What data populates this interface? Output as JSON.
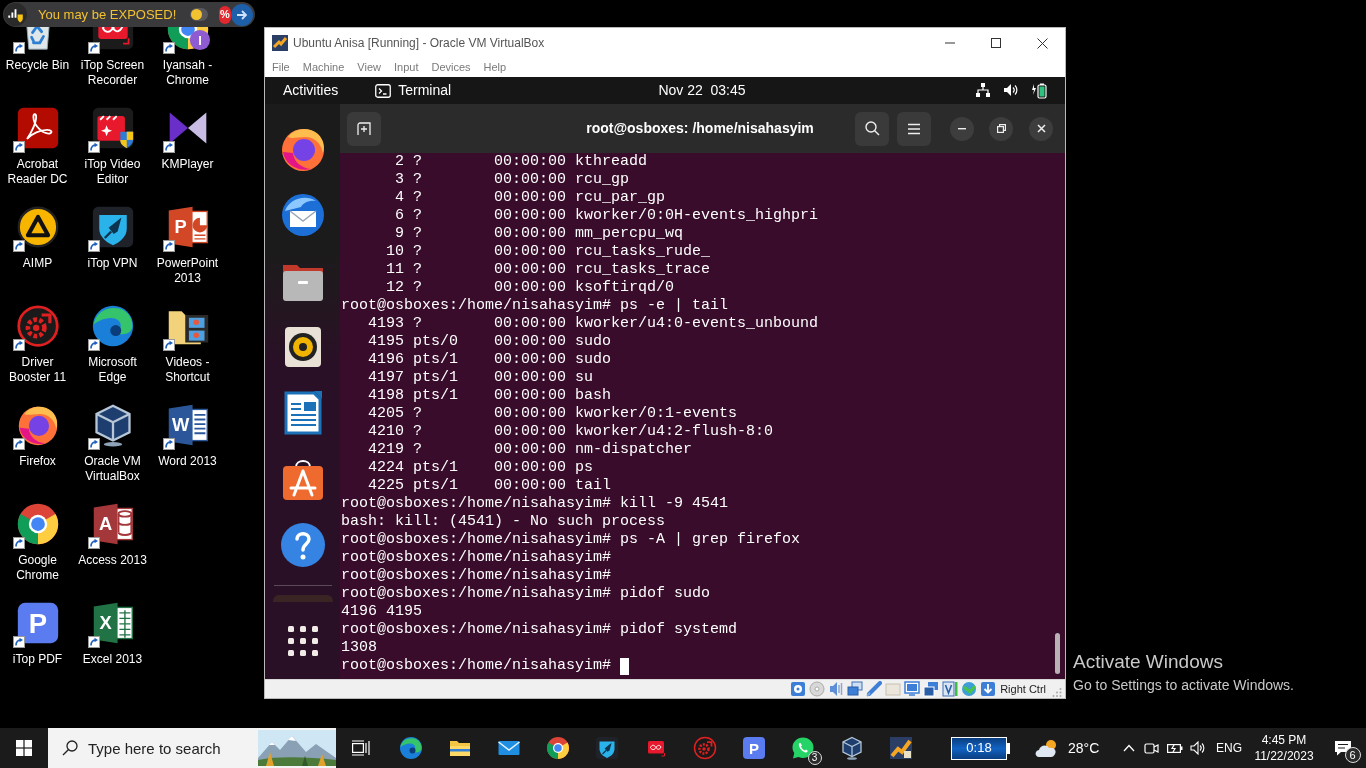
{
  "banner": {
    "text": "You may be EXPOSED!",
    "toggle": {
      "on": false
    },
    "badge": "%"
  },
  "desktop": {
    "columns": [
      [
        {
          "label": "Recycle Bin"
        },
        {
          "label": "Acrobat Reader DC"
        },
        {
          "label": "AIMP"
        },
        {
          "label": "Driver Booster 11"
        },
        {
          "label": "Firefox"
        },
        {
          "label": "Google Chrome"
        },
        {
          "label": "iTop PDF",
          "glyph": "P"
        }
      ],
      [
        {
          "label": "iTop Screen Recorder"
        },
        {
          "label": "iTop Video Editor"
        },
        {
          "label": "iTop VPN"
        },
        {
          "label": "Microsoft Edge"
        },
        {
          "label": "Oracle VM VirtualBox"
        },
        {
          "label": "Access 2013",
          "glyph": "A"
        },
        {
          "label": "Excel 2013",
          "glyph": "X"
        }
      ],
      [
        {
          "label": "Iyansah - Chrome",
          "glyph": "I"
        },
        {
          "label": "KMPlayer"
        },
        {
          "label": "PowerPoint 2013",
          "glyph": "P"
        },
        {
          "label": "Videos - Shortcut"
        },
        {
          "label": "Word 2013",
          "glyph": "W"
        }
      ]
    ]
  },
  "window": {
    "title": "Ubuntu Anisa [Running] - Oracle VM VirtualBox",
    "menu": [
      "File",
      "Machine",
      "View",
      "Input",
      "Devices",
      "Help"
    ],
    "status_bar": {
      "host_key": "Right Ctrl"
    }
  },
  "guest": {
    "top_bar": {
      "activities": "Activities",
      "app": "Terminal",
      "clock": "Nov 22  03:45"
    },
    "terminal": {
      "title": "root@osboxes: /home/nisahasyim",
      "lines": [
        "      2 ?        00:00:00 kthreadd",
        "      3 ?        00:00:00 rcu_gp",
        "      4 ?        00:00:00 rcu_par_gp",
        "      6 ?        00:00:00 kworker/0:0H-events_highpri",
        "      9 ?        00:00:00 mm_percpu_wq",
        "     10 ?        00:00:00 rcu_tasks_rude_",
        "     11 ?        00:00:00 rcu_tasks_trace",
        "     12 ?        00:00:00 ksoftirqd/0",
        "root@osboxes:/home/nisahasyim# ps -e | tail",
        "   4193 ?        00:00:00 kworker/u4:0-events_unbound",
        "   4195 pts/0    00:00:00 sudo",
        "   4196 pts/1    00:00:00 sudo",
        "   4197 pts/1    00:00:00 su",
        "   4198 pts/1    00:00:00 bash",
        "   4205 ?        00:00:00 kworker/0:1-events",
        "   4210 ?        00:00:00 kworker/u4:2-flush-8:0",
        "   4219 ?        00:00:00 nm-dispatcher",
        "   4224 pts/1    00:00:00 ps",
        "   4225 pts/1    00:00:00 tail",
        "root@osboxes:/home/nisahasyim# kill -9 4541",
        "bash: kill: (4541) - No such process",
        "root@osboxes:/home/nisahasyim# ps -A | grep firefox",
        "root@osboxes:/home/nisahasyim#",
        "root@osboxes:/home/nisahasyim#",
        "root@osboxes:/home/nisahasyim# pidof sudo",
        "4196 4195",
        "root@osboxes:/home/nisahasyim# pidof systemd",
        "1308",
        "root@osboxes:/home/nisahasyim#"
      ]
    }
  },
  "activation_notice": {
    "title": "Activate Windows",
    "message": "Go to Settings to activate Windows."
  },
  "taskbar": {
    "search": {
      "placeholder": "Type here to search"
    },
    "app_glyph": "P",
    "app_badge": "3",
    "timer": "0:18",
    "weather": "28°C",
    "language": "ENG",
    "time": "4:45 PM",
    "date": "11/22/2023",
    "notifications": "6"
  }
}
